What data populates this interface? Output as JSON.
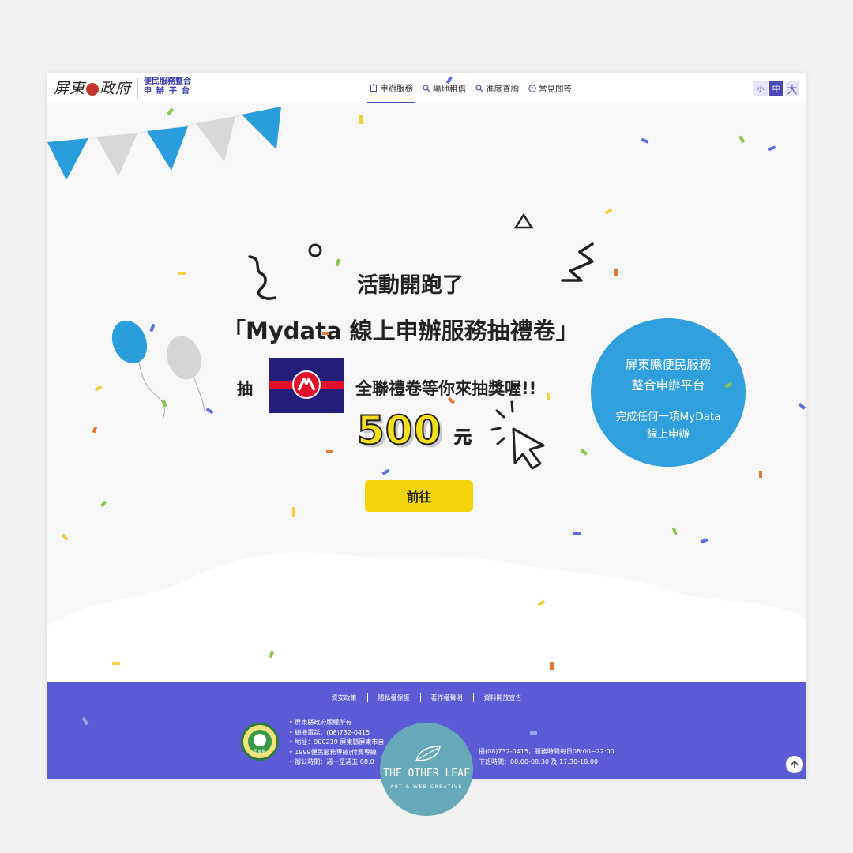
{
  "header": {
    "logo_text": "屏東",
    "logo_text2": "政府",
    "logo_sub_line1": "便民服務整合",
    "logo_sub_line2": "申辦平台",
    "nav": [
      {
        "label": "申辦服務",
        "icon": "clipboard-icon"
      },
      {
        "label": "場地租借",
        "icon": "search-icon"
      },
      {
        "label": "進度查詢",
        "icon": "search-icon"
      },
      {
        "label": "常見問答",
        "icon": "question-icon"
      }
    ],
    "font_sizes": {
      "small": "小",
      "medium": "中",
      "large": "大"
    }
  },
  "hero": {
    "title_line1": "活動開跑了",
    "title_line2": "「Mydata 線上申辦服務抽禮卷」",
    "draw_label": "抽",
    "prize_text": "全聯禮卷等你來抽獎喔!!",
    "amount": "500",
    "unit": "元",
    "cta_label": "前往",
    "bubble_line1": "屏東縣便民服務",
    "bubble_line2": "整合申辦平台",
    "bubble_line3": "完成任何一項MyData",
    "bubble_line4": "線上申辦"
  },
  "footer": {
    "links": [
      "資安政策",
      "隱私權保護",
      "著作權聲明",
      "資料開放宣告"
    ],
    "info": [
      "屏東縣政府版權所有",
      "總機電話：(08)732-0415",
      "地址：900219 屏東縣屏東市自",
      "1999便民服務專線(付費專線",
      "辦公時間：週一至週五 08:0"
    ],
    "info_right": [
      "播(08)732-0415，服務時間每日08:00~22:00",
      "下班時間：08:00-08:30 及 17:30-18:00"
    ],
    "emblem_text": "屏東縣"
  },
  "watermark": {
    "line1": "THE OTHER LEAF",
    "line2": "ART & WEB CREATIVE"
  },
  "colors": {
    "accent": "#4a4ab3",
    "footer_bg": "#5b5bd6",
    "bubble": "#2f9fde",
    "button": "#f1d50a",
    "flag_blue": "#2a9ddc",
    "flag_gray": "#d8d8d8"
  }
}
